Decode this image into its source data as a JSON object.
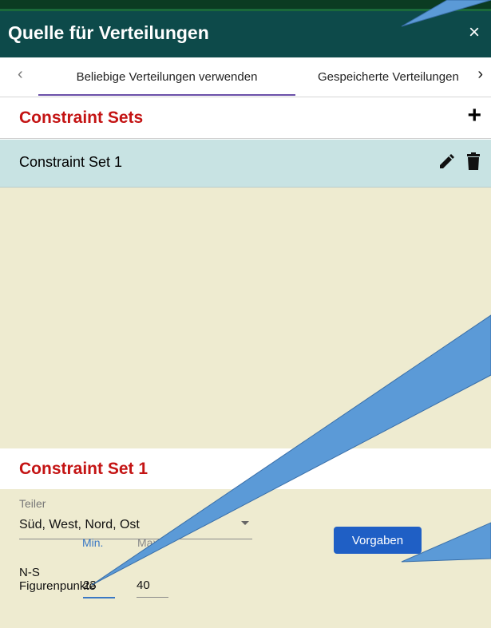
{
  "dialog": {
    "title": "Quelle für Verteilungen",
    "close_glyph": "×"
  },
  "tabs": {
    "left_arrow": "‹",
    "right_arrow": "›",
    "items": [
      {
        "label": "Beliebige Verteilungen verwenden",
        "active": true
      },
      {
        "label": "Gespeicherte Verteilungen",
        "active": false
      }
    ]
  },
  "constraint_sets": {
    "heading": "Constraint Sets",
    "add_glyph": "+",
    "items": [
      {
        "label": "Constraint Set 1"
      }
    ]
  },
  "detail": {
    "heading": "Constraint Set 1",
    "teiler_label": "Teiler",
    "teiler_value": "Süd, West, Nord, Ost",
    "ns_label_line1": "N-S",
    "ns_label_line2": "Figurenpunkte",
    "min_label": "Min.",
    "max_label": "Max.",
    "min_value": "23",
    "max_value": "40",
    "defaults_button": "Vorgaben"
  },
  "colors": {
    "header": "#0d4a4a",
    "heading_red": "#c41414",
    "selected_row": "#c8e3e3",
    "panel": "#eeebd0",
    "button": "#1f5fc5",
    "callout": "#5b9ad7"
  }
}
